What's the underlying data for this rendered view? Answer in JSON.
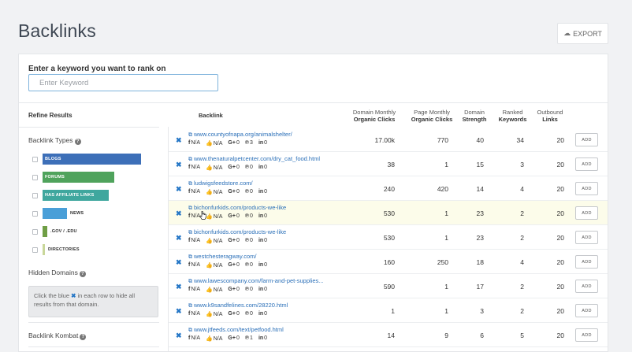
{
  "page_title": "Backlinks",
  "export_label": "EXPORT",
  "keyword": {
    "label": "Enter a keyword you want to rank on",
    "placeholder": "Enter Keyword"
  },
  "refine_results": "Refine Results",
  "columns": {
    "backlink": "Backlink",
    "domain_clicks": [
      "Domain Monthly",
      "Organic Clicks"
    ],
    "page_clicks": [
      "Page Monthly",
      "Organic Clicks"
    ],
    "domain_strength": [
      "Domain",
      "Strength"
    ],
    "ranked_keywords": [
      "Ranked",
      "Keywords"
    ],
    "outbound_links": [
      "Outbound",
      "Links"
    ]
  },
  "backlink_types": {
    "title": "Backlink Types",
    "items": [
      {
        "label": "BLOGS",
        "color": "#3d6fb8",
        "fill": 1.0
      },
      {
        "label": "FORUMS",
        "color": "#4fa35c",
        "fill": 0.73
      },
      {
        "label": "HAS AFFILIATE LINKS",
        "color": "#3fa79e",
        "fill": 0.67
      },
      {
        "label": "NEWS",
        "color": "#4a9fd8",
        "fill": 0.25
      },
      {
        "label": ".GOV / .EDU",
        "color": "#6f9e45",
        "fill": 0.05
      },
      {
        "label": "DIRECTORIES",
        "color": "#c9d79a",
        "fill": 0.02
      }
    ]
  },
  "hidden_domains": {
    "title": "Hidden Domains",
    "note_pre": "Click the blue",
    "note_x": "✖",
    "note_post": "in each row to hide all results from that domain."
  },
  "backlink_kombat": {
    "title": "Backlink Kombat"
  },
  "rows": [
    {
      "url": "www.countyofnapa.org/animalshelter/",
      "fb": "N/A",
      "like": "N/A",
      "gplus": "0",
      "pin": "3",
      "li": "0",
      "domain_clicks": "17.00k",
      "page_clicks": "770",
      "strength": "40",
      "keywords": "34",
      "outbound": "20",
      "highlight": false
    },
    {
      "url": "www.thenaturalpetcenter.com/dry_cat_food.html",
      "fb": "N/A",
      "like": "N/A",
      "gplus": "0",
      "pin": "0",
      "li": "0",
      "domain_clicks": "38",
      "page_clicks": "1",
      "strength": "15",
      "keywords": "3",
      "outbound": "20",
      "highlight": false
    },
    {
      "url": "ludwigsfeedstore.com/",
      "fb": "N/A",
      "like": "N/A",
      "gplus": "0",
      "pin": "0",
      "li": "0",
      "domain_clicks": "240",
      "page_clicks": "420",
      "strength": "14",
      "keywords": "4",
      "outbound": "20",
      "highlight": false
    },
    {
      "url": "bichonfurkids.com/products-we-like",
      "fb": "N/A",
      "like": "N/A",
      "gplus": "0",
      "pin": "0",
      "li": "0",
      "domain_clicks": "530",
      "page_clicks": "1",
      "strength": "23",
      "keywords": "2",
      "outbound": "20",
      "highlight": true
    },
    {
      "url": "bichonfurkids.com/products-we-like",
      "fb": "N/A",
      "like": "N/A",
      "gplus": "0",
      "pin": "0",
      "li": "0",
      "domain_clicks": "530",
      "page_clicks": "1",
      "strength": "23",
      "keywords": "2",
      "outbound": "20",
      "highlight": false
    },
    {
      "url": "westchesteragway.com/",
      "fb": "N/A",
      "like": "N/A",
      "gplus": "0",
      "pin": "0",
      "li": "0",
      "domain_clicks": "160",
      "page_clicks": "250",
      "strength": "18",
      "keywords": "4",
      "outbound": "20",
      "highlight": false
    },
    {
      "url": "www.lawescompany.com/farm-and-pet-supplies...",
      "fb": "N/A",
      "like": "N/A",
      "gplus": "0",
      "pin": "0",
      "li": "0",
      "domain_clicks": "590",
      "page_clicks": "1",
      "strength": "17",
      "keywords": "2",
      "outbound": "20",
      "highlight": false
    },
    {
      "url": "www.k9sandfelines.com/28220.html",
      "fb": "N/A",
      "like": "N/A",
      "gplus": "0",
      "pin": "0",
      "li": "0",
      "domain_clicks": "1",
      "page_clicks": "1",
      "strength": "3",
      "keywords": "2",
      "outbound": "20",
      "highlight": false
    },
    {
      "url": "www.jtfeeds.com/text/petfood.html",
      "fb": "N/A",
      "like": "N/A",
      "gplus": "0",
      "pin": "1",
      "li": "0",
      "domain_clicks": "14",
      "page_clicks": "9",
      "strength": "6",
      "keywords": "5",
      "outbound": "20",
      "highlight": false
    }
  ],
  "add_label": "ADD"
}
